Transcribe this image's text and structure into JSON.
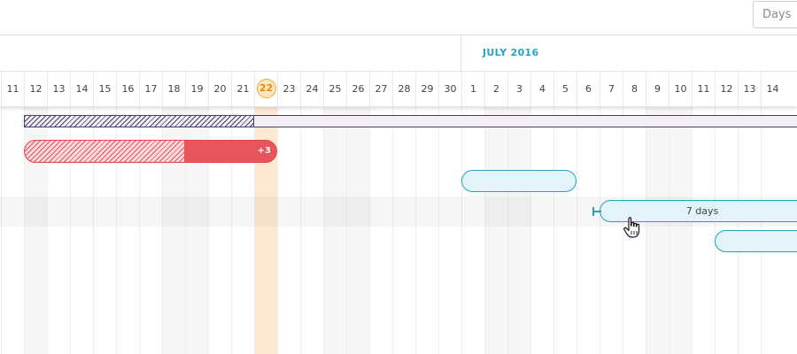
{
  "toolbar": {
    "zoom_value": "Days"
  },
  "timeline": {
    "month_label": "JULY 2016",
    "days": [
      "11",
      "12",
      "13",
      "14",
      "15",
      "16",
      "17",
      "18",
      "19",
      "20",
      "21",
      "22",
      "23",
      "24",
      "25",
      "26",
      "27",
      "28",
      "29",
      "30",
      "1",
      "2",
      "3",
      "4",
      "5",
      "6",
      "7",
      "8",
      "9",
      "10",
      "11",
      "12",
      "13",
      "14"
    ],
    "today_index": 11,
    "weekend_indices": [
      1,
      7,
      8,
      14,
      15,
      21,
      22,
      28,
      29
    ]
  },
  "tasks": {
    "red_bar_badge": "+3",
    "duration_label": "7 days"
  },
  "colors": {
    "accent_teal": "#29a3c6",
    "today_orange": "#f08a00",
    "critical_red": "#e8545c",
    "summary_purple": "#4b3c68"
  }
}
